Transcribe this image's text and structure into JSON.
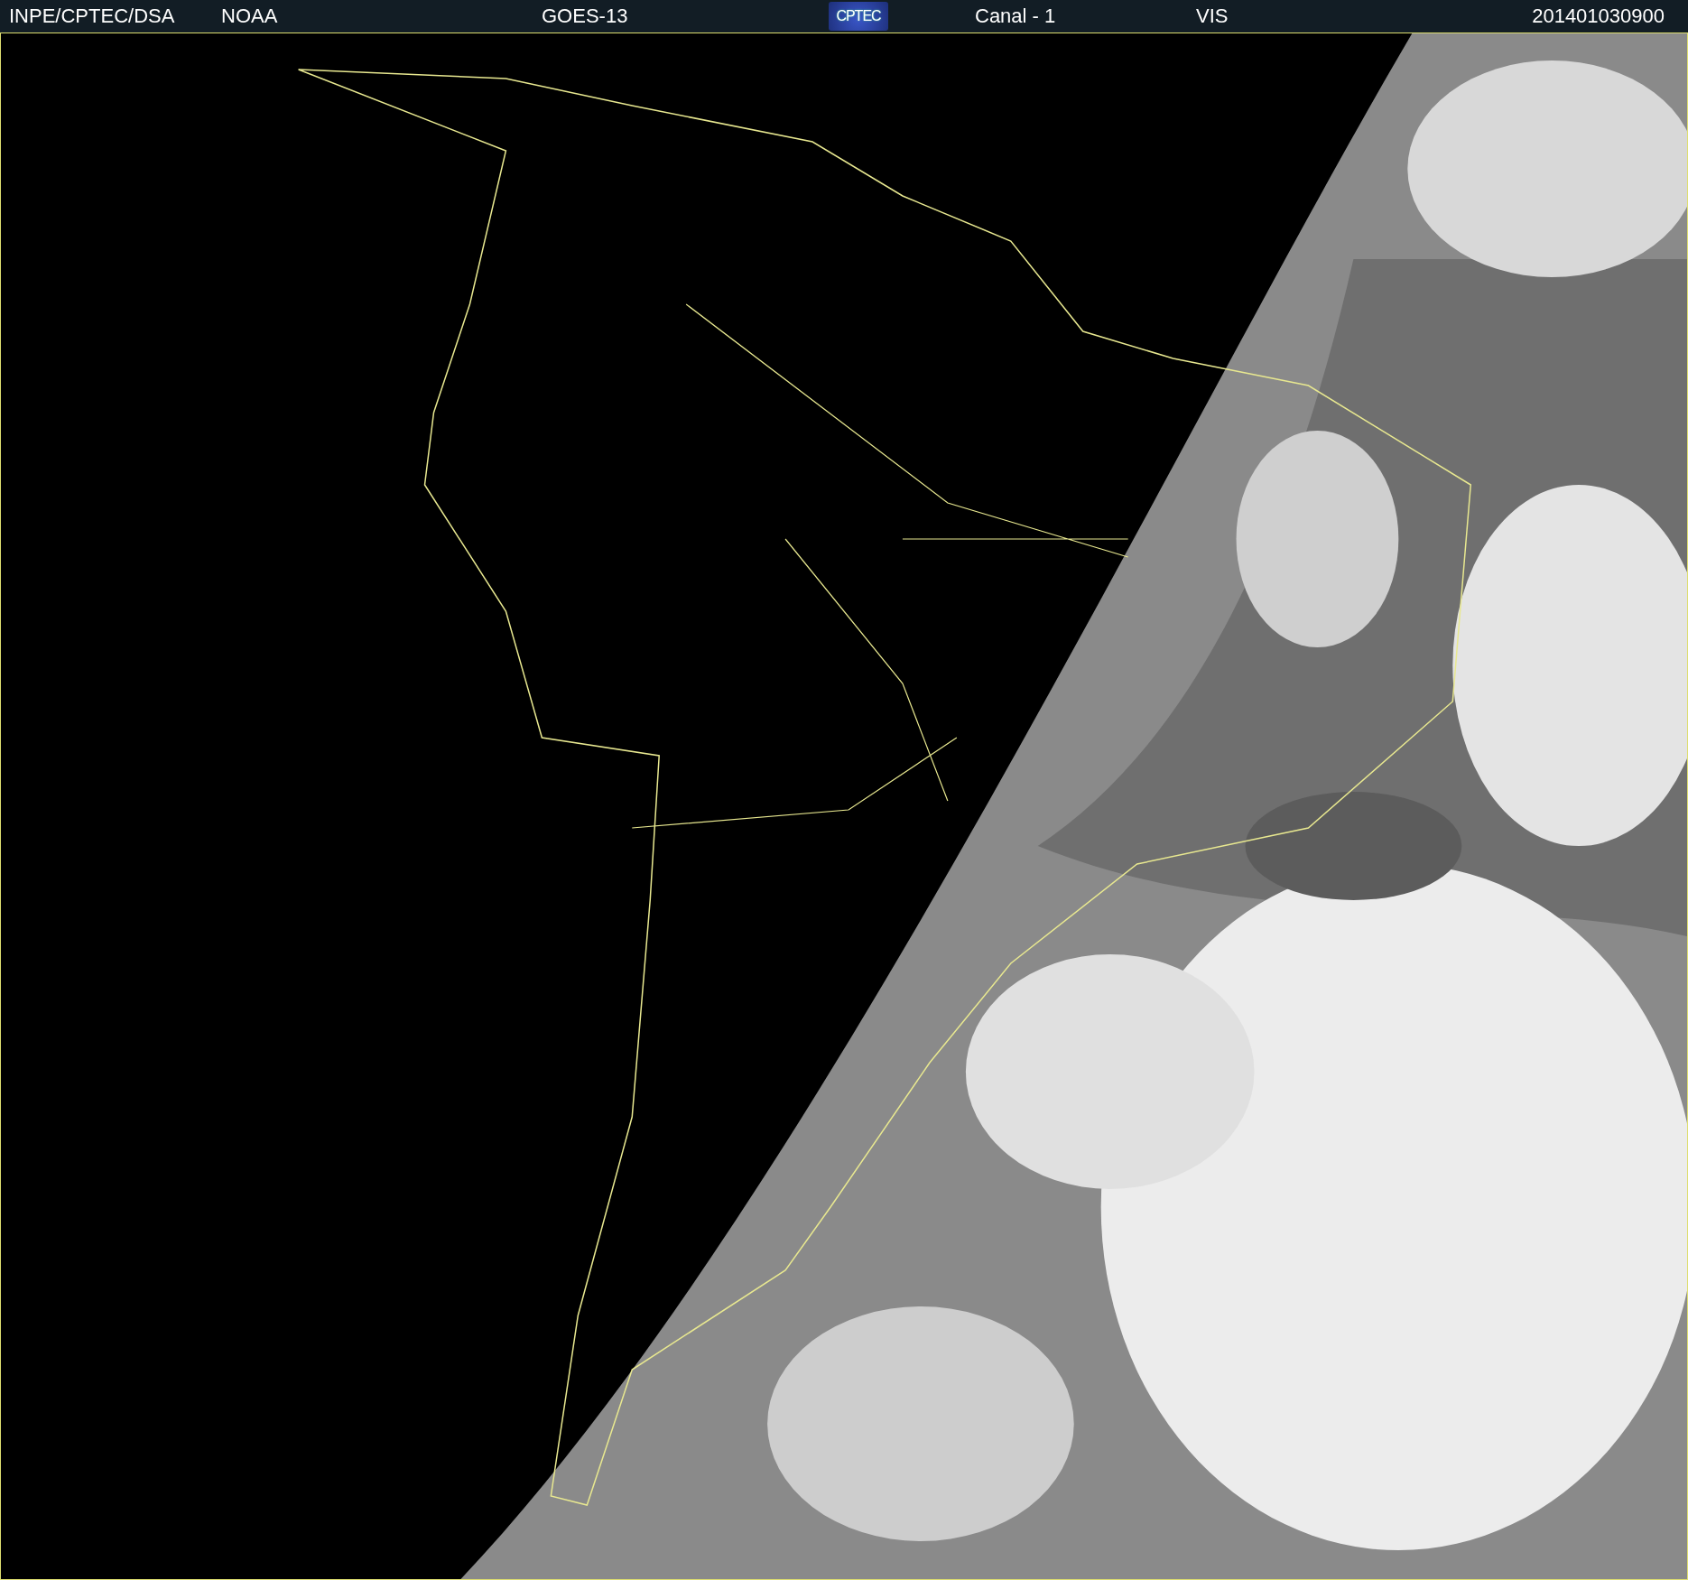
{
  "header": {
    "source": "INPE/CPTEC/DSA",
    "agency": "NOAA",
    "satellite": "GOES-13",
    "logo_text": "CPTEC",
    "channel": "Canal - 1",
    "band": "VIS",
    "timestamp": "201401030900"
  }
}
